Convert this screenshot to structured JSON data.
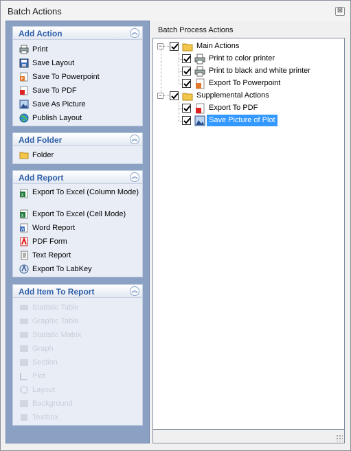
{
  "window": {
    "title": "Batch Actions",
    "close_glyph": "⊠"
  },
  "left": {
    "groups": [
      {
        "title": "Add Action",
        "items": [
          {
            "label": "Print",
            "icon": "printer-icon"
          },
          {
            "label": "Save Layout",
            "icon": "floppy-icon"
          },
          {
            "label": "Save To Powerpoint",
            "icon": "powerpoint-icon"
          },
          {
            "label": "Save To PDF",
            "icon": "pdf-icon"
          },
          {
            "label": "Save As Picture",
            "icon": "picture-icon"
          },
          {
            "label": "Publish Layout",
            "icon": "globe-icon"
          }
        ]
      },
      {
        "title": "Add Folder",
        "items": [
          {
            "label": "Folder",
            "icon": "folder-icon"
          }
        ]
      },
      {
        "title": "Add Report",
        "items": [
          {
            "label": "Export To Excel (Column Mode)",
            "icon": "excel-icon"
          },
          {
            "label": "Export To Excel (Cell Mode)",
            "icon": "excel-icon"
          },
          {
            "label": "Word Report",
            "icon": "word-icon"
          },
          {
            "label": "PDF Form",
            "icon": "pdf-form-icon"
          },
          {
            "label": "Text Report",
            "icon": "text-report-icon"
          },
          {
            "label": "Export To LabKey",
            "icon": "labkey-icon"
          }
        ]
      },
      {
        "title": "Add Item To Report",
        "items": [
          {
            "label": "Statistic Table"
          },
          {
            "label": "Graphic Table"
          },
          {
            "label": "Statistic Matrix"
          },
          {
            "label": "Graph"
          },
          {
            "label": "Section"
          },
          {
            "label": "Plot"
          },
          {
            "label": "Layout"
          },
          {
            "label": "Background"
          },
          {
            "label": "Textbox"
          }
        ]
      }
    ]
  },
  "right": {
    "header": "Batch Process Actions",
    "tree": {
      "main": {
        "label": "Main Actions",
        "children": [
          {
            "label": "Print to color printer"
          },
          {
            "label": "Print to black and white printer"
          },
          {
            "label": "Export To Powerpoint"
          }
        ]
      },
      "supplemental": {
        "label": "Supplemental Actions",
        "children": [
          {
            "label": "Export To PDF"
          },
          {
            "label": "Save Picture of Plot"
          }
        ]
      }
    }
  },
  "colors": {
    "accent": "#2e5fa8",
    "selection": "#3399ff",
    "pane": "#8aa1c3"
  }
}
